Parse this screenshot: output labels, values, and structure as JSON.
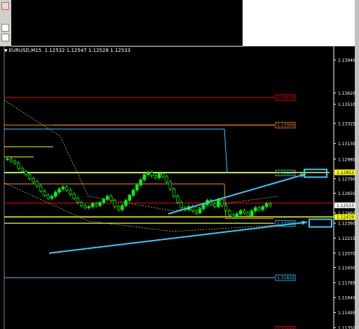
{
  "window": {
    "title": "EURUSD,M15",
    "quote": "1.12532 1.12547 1.12528 1.12533"
  },
  "colors": {
    "background": "#000000",
    "candles": "#00ff00",
    "support_resistance": "#ffff00",
    "trend_arrows": "#33ccff",
    "red_level": "#ff0000",
    "orange_level": "#ff8c00",
    "axis_text": "#ffffff"
  },
  "chart_data": {
    "type": "candlestick",
    "symbol": "EURUSD",
    "timeframe": "M15",
    "ohlc": {
      "open": 1.12532,
      "high": 1.12547,
      "low": 1.12528,
      "close": 1.12533
    },
    "ylim": [
      1.11336,
      1.14071
    ],
    "y_ticks": [
      "1.13940",
      "1.13620",
      "1.13510",
      "1.13325",
      "1.13130",
      "1.12980",
      "1.12790",
      "1.12650",
      "1.12460",
      "1.12360",
      "1.12215",
      "1.12070",
      "1.11930",
      "1.11785",
      "1.11640",
      "1.11495",
      "1.11350"
    ],
    "current_price_label": "1.12533",
    "price_markers": [
      {
        "label": "1.12852",
        "value": 1.12852,
        "color": "#ffff00"
      },
      {
        "label": "1.12419",
        "value": 1.12419,
        "color": "#ffff00"
      }
    ],
    "levels": [
      {
        "label": "1.13576",
        "value": 1.13576,
        "color": "#ff0000"
      },
      {
        "label": "1.13309",
        "value": 1.13309,
        "color": "#ff8c00"
      },
      {
        "label": "1.12845",
        "value": 1.12845,
        "color": "#33ccff"
      },
      {
        "label": "1.12358",
        "value": 1.12358,
        "color": "#33ccff"
      },
      {
        "label": "1.11832",
        "value": 1.11832,
        "color": "#33ccff"
      },
      {
        "label": "1.11333",
        "value": 1.11333,
        "color": "#ff0000"
      }
    ],
    "close_series": [
      1.1298,
      1.1296,
      1.1294,
      1.1289,
      1.1286,
      1.1283,
      1.1279,
      1.1276,
      1.1272,
      1.1267,
      1.1263,
      1.126,
      1.1262,
      1.1266,
      1.1269,
      1.1271,
      1.1268,
      1.1264,
      1.126,
      1.1256,
      1.1253,
      1.1251,
      1.1252,
      1.1255,
      1.1253,
      1.1256,
      1.1259,
      1.1262,
      1.1258,
      1.1252,
      1.1249,
      1.1253,
      1.1258,
      1.1263,
      1.1268,
      1.1273,
      1.1278,
      1.1283,
      1.1285,
      1.1282,
      1.128,
      1.1284,
      1.1281,
      1.1276,
      1.1269,
      1.1262,
      1.1256,
      1.1251,
      1.1249,
      1.1252,
      1.1248,
      1.1246,
      1.125,
      1.1254,
      1.1258,
      1.1255,
      1.1252,
      1.1259,
      1.1253,
      1.1248,
      1.1244,
      1.1242,
      1.1245,
      1.1248,
      1.1246,
      1.1243,
      1.1248,
      1.1251,
      1.1249,
      1.1252,
      1.1255,
      1.1253
    ]
  }
}
